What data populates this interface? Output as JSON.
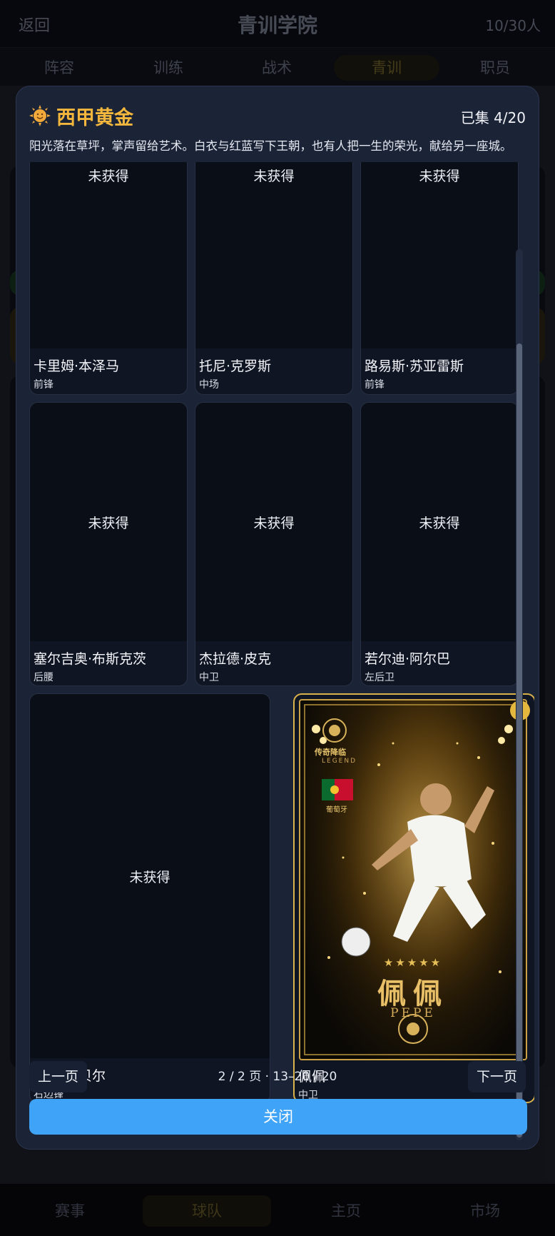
{
  "topbar": {
    "back_label": "返回",
    "title": "青训学院",
    "count": "10/30人"
  },
  "tabs": [
    {
      "label": "阵容"
    },
    {
      "label": "训练"
    },
    {
      "label": "战术"
    },
    {
      "label": "青训"
    },
    {
      "label": "职员"
    }
  ],
  "bottom_nav": [
    {
      "label": "赛事"
    },
    {
      "label": "球队"
    },
    {
      "label": "主页"
    },
    {
      "label": "市场"
    }
  ],
  "modal": {
    "set_title": "西甲黄金",
    "collected": "已集 4/20",
    "description": "阳光落在草坪，掌声留给艺术。白衣与红蓝写下王朝，也有人把一生的荣光，献给另一座城。",
    "locked_label": "未获得",
    "cards": [
      {
        "name": "卡里姆·本泽马",
        "position": "前锋",
        "owned": false
      },
      {
        "name": "托尼·克罗斯",
        "position": "中场",
        "owned": false
      },
      {
        "name": "路易斯·苏亚雷斯",
        "position": "前锋",
        "owned": false
      },
      {
        "name": "塞尔吉奥·布斯克茨",
        "position": "后腰",
        "owned": false
      },
      {
        "name": "杰拉德·皮克",
        "position": "中卫",
        "owned": false
      },
      {
        "name": "若尔迪·阿尔巴",
        "position": "左后卫",
        "owned": false
      },
      {
        "name": "加雷斯·贝尔",
        "position": "右边锋",
        "owned": false
      },
      {
        "name": "佩佩",
        "position": "中卫",
        "owned": true
      }
    ],
    "legend_card": {
      "badge_text": "传奇降临",
      "badge_sub": "LEGEND",
      "country": "葡萄牙",
      "name_cn": "佩佩",
      "name_en": "PEPE",
      "stars": "★★★★★"
    },
    "prev_label": "上一页",
    "next_label": "下一页",
    "page_info": "2 / 2 页 · 13–20 / 20",
    "close_label": "关闭"
  },
  "colors": {
    "accent": "#3fa3f7",
    "gold": "#f2b73c",
    "modal_bg": "#1b2336"
  }
}
